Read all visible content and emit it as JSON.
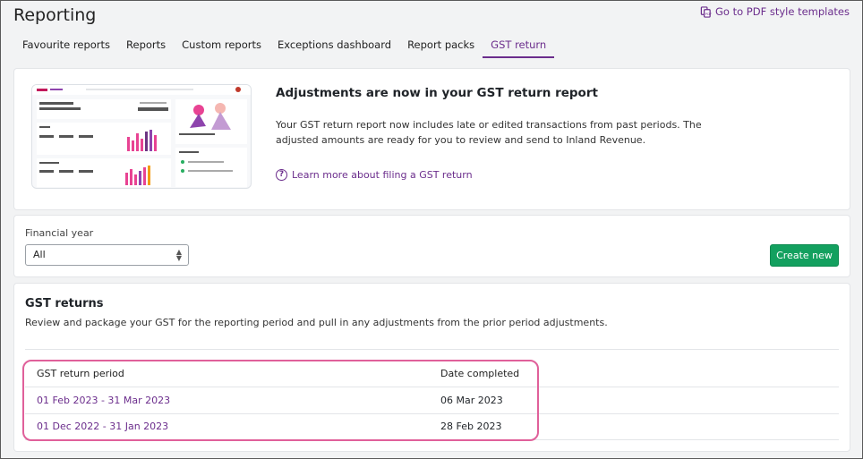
{
  "page": {
    "title": "Reporting",
    "pdf_link": "Go to PDF style templates"
  },
  "tabs": [
    {
      "label": "Favourite reports",
      "active": false
    },
    {
      "label": "Reports",
      "active": false
    },
    {
      "label": "Custom reports",
      "active": false
    },
    {
      "label": "Exceptions dashboard",
      "active": false
    },
    {
      "label": "Report packs",
      "active": false
    },
    {
      "label": "GST return",
      "active": true
    }
  ],
  "banner": {
    "heading": "Adjustments are now in your GST return report",
    "text": "Your GST return report now includes late or edited transactions from past periods. The adjusted amounts are ready for you to review and send to Inland Revenue.",
    "link": "Learn more about filing a GST return"
  },
  "filter": {
    "label": "Financial year",
    "selected": "All",
    "create_button": "Create new"
  },
  "returns": {
    "title": "GST returns",
    "description": "Review and package your GST for the reporting period and pull in any adjustments from the prior period adjustments.",
    "columns": [
      "GST return period",
      "Date completed"
    ],
    "rows": [
      {
        "period": "01 Feb 2023 - 31 Mar 2023",
        "date": "06 Mar 2023"
      },
      {
        "period": "01 Dec 2022 - 31 Jan 2023",
        "date": "28 Feb 2023"
      }
    ]
  },
  "colors": {
    "accent": "#6b2d8c",
    "create_button": "#13a05f",
    "highlight": "#e0609a"
  }
}
